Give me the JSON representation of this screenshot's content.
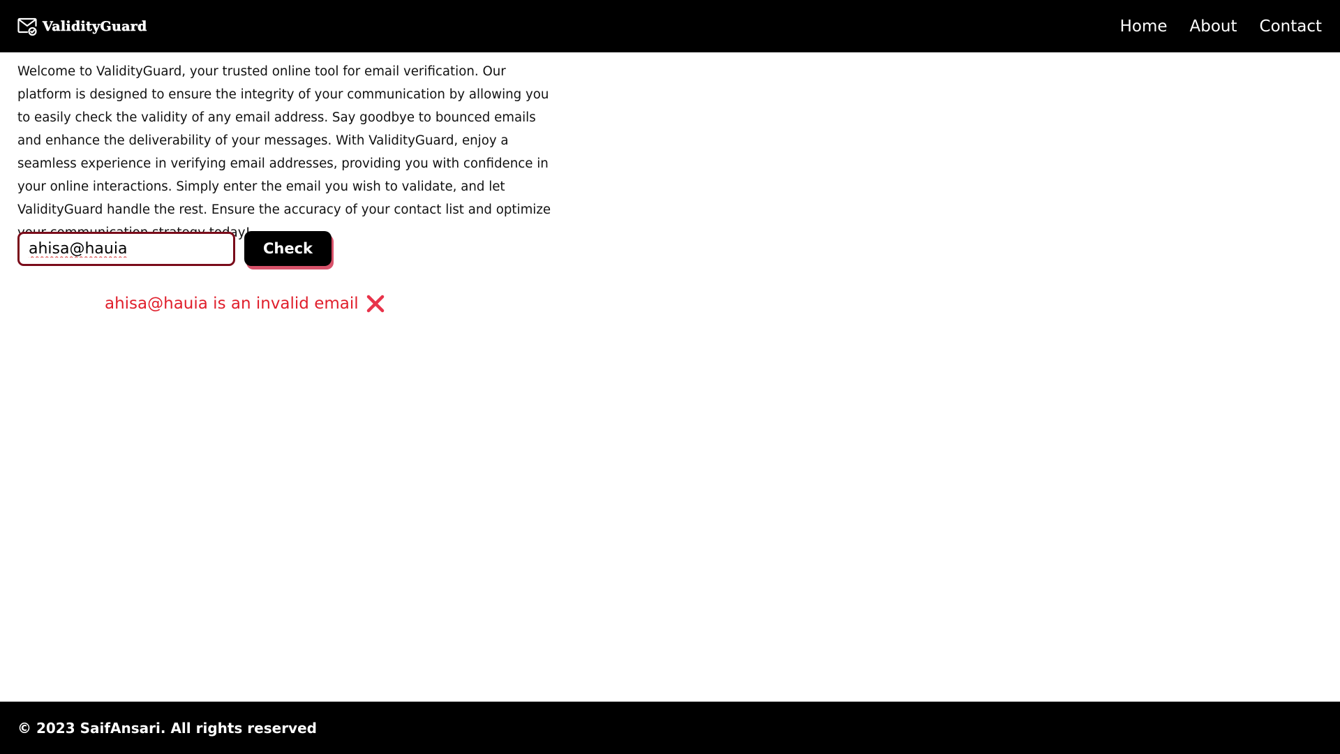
{
  "header": {
    "brand_name": "ValidityGuard",
    "brand_icon": "mail-check-icon",
    "nav": [
      {
        "label": "Home"
      },
      {
        "label": "About"
      },
      {
        "label": "Contact"
      }
    ]
  },
  "main": {
    "intro_text": "Welcome to ValidityGuard, your trusted online tool for email verification. Our platform is designed to ensure the integrity of your communication by allowing you to easily check the validity of any email address. Say goodbye to bounced emails and enhance the deliverability of your messages. With ValidityGuard, enjoy a seamless experience in verifying email addresses, providing you with confidence in your online interactions. Simply enter the email you wish to validate, and let ValidityGuard handle the rest. Ensure the accuracy of your contact list and optimize your communication strategy today!",
    "email_input": {
      "value": "ahisa@hauia",
      "placeholder": ""
    },
    "check_button_label": "Check",
    "result": {
      "message": "ahisa@hauia is an invalid email",
      "icon": "cross-mark-icon",
      "color": "#e01e2b"
    }
  },
  "footer": {
    "copyright": "© 2023 SaifAnsari. All rights reserved"
  },
  "colors": {
    "header_bg": "#000000",
    "footer_bg": "#000000",
    "input_border": "#7a0b1a",
    "button_shadow": "#d8526a",
    "error": "#e01e2b"
  }
}
